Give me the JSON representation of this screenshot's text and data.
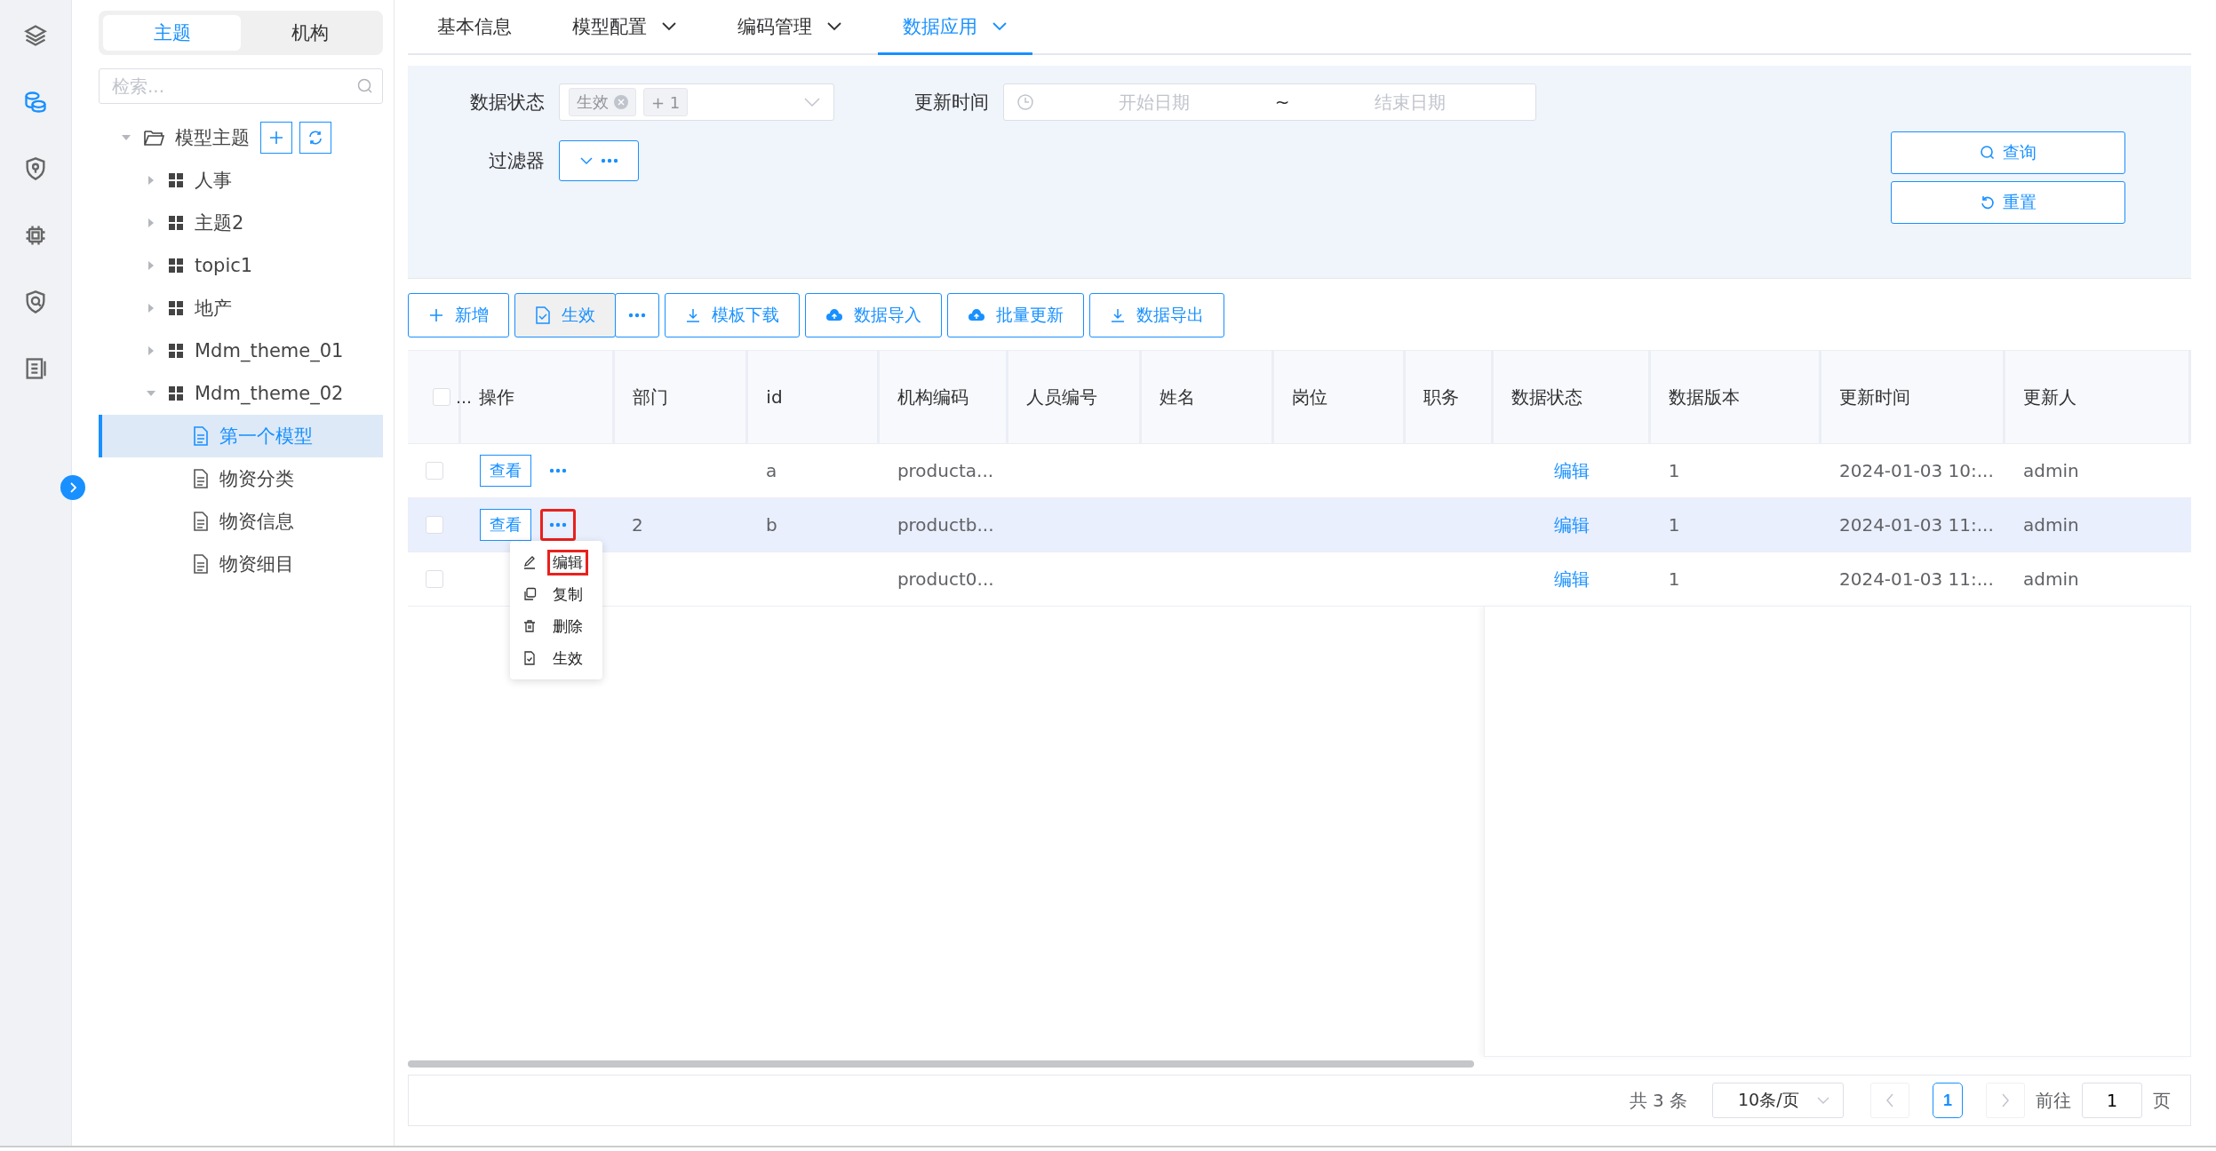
{
  "rail": {
    "icons": [
      {
        "kind": "layers",
        "selected": false
      },
      {
        "kind": "database",
        "selected": true
      },
      {
        "kind": "shield-key",
        "selected": false
      },
      {
        "kind": "chip",
        "selected": false
      },
      {
        "kind": "shield-search",
        "selected": false
      },
      {
        "kind": "document",
        "selected": false
      }
    ]
  },
  "tree_panel": {
    "tabs": [
      {
        "label": "主题",
        "selected": true
      },
      {
        "label": "机构",
        "selected": false
      }
    ],
    "search": {
      "placeholder": "检索..."
    },
    "tree": [
      {
        "kind": "folder",
        "label": "模型主题",
        "expanded": true,
        "children": [
          {
            "kind": "theme",
            "label": "人事",
            "expanded": false
          },
          {
            "kind": "theme",
            "label": "主题2",
            "expanded": false
          },
          {
            "kind": "theme",
            "label": "topic1",
            "expanded": false
          },
          {
            "kind": "theme",
            "label": "地产",
            "expanded": false
          },
          {
            "kind": "theme",
            "label": "Mdm_theme_01",
            "expanded": false
          },
          {
            "kind": "theme",
            "label": "Mdm_theme_02",
            "expanded": true,
            "children": [
              {
                "kind": "model",
                "label": "第一个模型",
                "selected": true
              },
              {
                "kind": "model",
                "label": "物资分类",
                "selected": false
              },
              {
                "kind": "model",
                "label": "物资信息",
                "selected": false
              },
              {
                "kind": "model",
                "label": "物资细目",
                "selected": false
              }
            ]
          }
        ]
      }
    ]
  },
  "tabs": [
    {
      "label": "基本信息",
      "dropdown": false,
      "selected": false
    },
    {
      "label": "模型配置",
      "dropdown": true,
      "selected": false
    },
    {
      "label": "编码管理",
      "dropdown": true,
      "selected": false
    },
    {
      "label": "数据应用",
      "dropdown": true,
      "selected": true
    }
  ],
  "filters": {
    "data_status": {
      "label": "数据状态",
      "tags": [
        {
          "text": "生效",
          "closable": true
        },
        {
          "text": "+ 1",
          "closable": false
        }
      ]
    },
    "update_time": {
      "label": "更新时间",
      "start_placeholder": "开始日期",
      "separator": "~",
      "end_placeholder": "结束日期"
    },
    "filter": {
      "label": "过滤器"
    },
    "buttons": [
      {
        "kind": "search",
        "label": "查询"
      },
      {
        "kind": "reset",
        "label": "重置"
      }
    ]
  },
  "toolbar": [
    {
      "kind": "add",
      "label": "新增",
      "pressed": false
    },
    {
      "kind": "activate",
      "label": "生效",
      "pressed": true
    },
    {
      "kind": "more",
      "pressed": false
    },
    {
      "kind": "download",
      "label": "模板下载",
      "pressed": false
    },
    {
      "kind": "cloud",
      "label": "数据导入",
      "pressed": false
    },
    {
      "kind": "cloud",
      "label": "批量更新",
      "pressed": false
    },
    {
      "kind": "download",
      "label": "数据导出",
      "pressed": false
    }
  ],
  "table": {
    "select_all": {
      "checked": false,
      "label": "…"
    },
    "actions_column": "操作",
    "columns": [
      {
        "label": "部门",
        "kind": "text"
      },
      {
        "label": "id",
        "kind": "text"
      },
      {
        "label": "机构编码",
        "kind": "text"
      },
      {
        "label": "人员编号",
        "kind": "text"
      },
      {
        "label": "姓名",
        "kind": "text"
      },
      {
        "label": "岗位",
        "kind": "text"
      },
      {
        "label": "职务",
        "kind": "text"
      },
      {
        "label": "数据状态",
        "kind": "link"
      },
      {
        "label": "数据版本",
        "kind": "text"
      },
      {
        "label": "更新时间",
        "kind": "text"
      },
      {
        "label": "更新人",
        "kind": "text"
      }
    ],
    "rows": [
      {
        "selected": false,
        "checked": false,
        "view_button": "查看",
        "more_annotated": false,
        "cells": [
          "",
          "a",
          "producta...",
          "",
          "",
          "",
          "",
          "编辑",
          "1",
          "2024-01-03 10:...",
          "admin"
        ]
      },
      {
        "selected": true,
        "checked": false,
        "view_button": "查看",
        "more_annotated": true,
        "cells": [
          "2",
          "b",
          "productb...",
          "",
          "",
          "",
          "",
          "编辑",
          "1",
          "2024-01-03 11:...",
          "admin"
        ],
        "menu": [
          {
            "kind": "edit",
            "label": "编辑",
            "annotated": true
          },
          {
            "kind": "copy",
            "label": "复制",
            "annotated": false
          },
          {
            "kind": "delete",
            "label": "删除",
            "annotated": false
          },
          {
            "kind": "activate",
            "label": "生效",
            "annotated": false
          }
        ]
      },
      {
        "selected": false,
        "checked": false,
        "cells": [
          "",
          "",
          "product0...",
          "",
          "",
          "",
          "",
          "编辑",
          "1",
          "2024-01-03 11:...",
          "admin"
        ]
      }
    ]
  },
  "pagination": {
    "total": "共 3 条",
    "page_size": "10条/页",
    "pages": [
      {
        "label": "1",
        "selected": true
      }
    ],
    "goto_label": "前往",
    "goto_value": "1",
    "page_suffix": "页"
  }
}
